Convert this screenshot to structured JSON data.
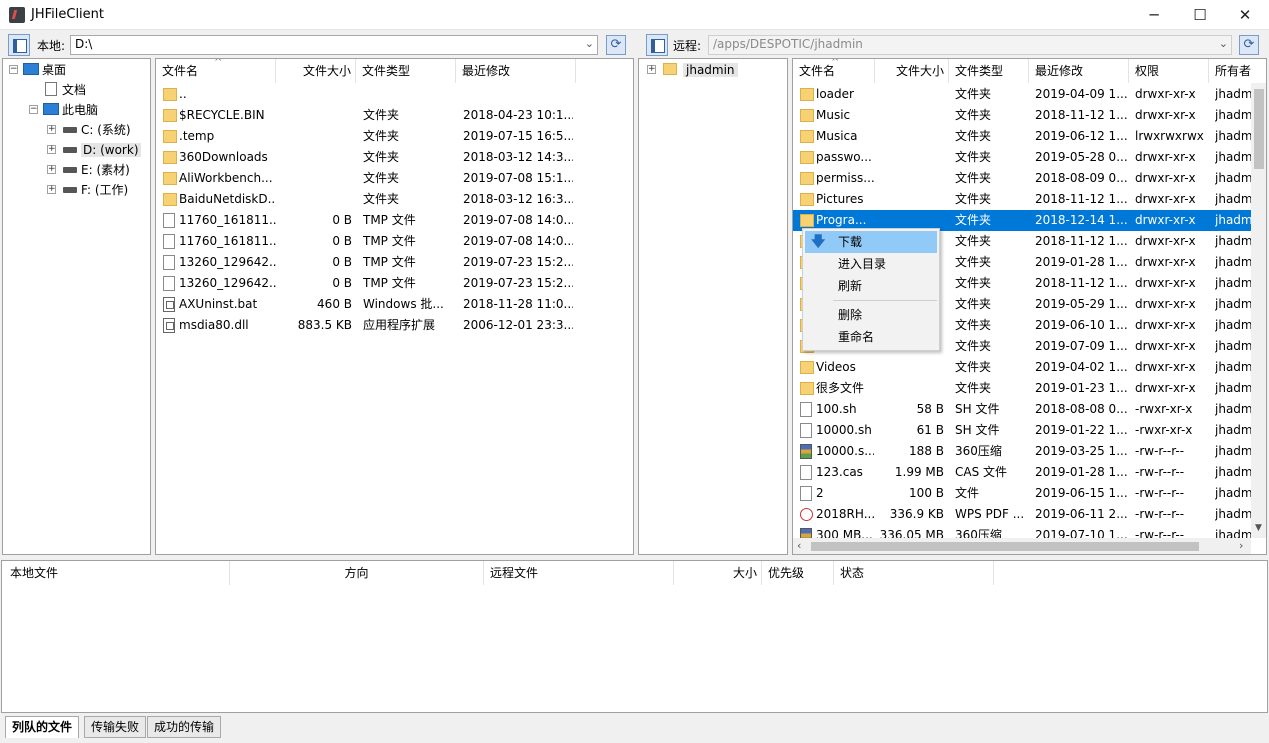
{
  "window": {
    "title": "JHFileClient",
    "minimize": "─",
    "maximize": "☐",
    "close": "✕"
  },
  "local": {
    "label": "本地:",
    "path": "D:\\"
  },
  "remote": {
    "label": "远程:",
    "path": "/apps/DESPOTIC/jhadmin"
  },
  "local_tree": [
    {
      "label": "桌面",
      "icon": "desktop-icon"
    },
    {
      "label": "文档",
      "icon": "document-icon"
    },
    {
      "label": "此电脑",
      "icon": "computer-icon"
    },
    {
      "label": "C: (系统)",
      "icon": "drive-icon"
    },
    {
      "label": "D: (work)",
      "icon": "drive-icon"
    },
    {
      "label": "E: (素材)",
      "icon": "drive-icon"
    },
    {
      "label": "F: (工作)",
      "icon": "drive-icon"
    }
  ],
  "local_columns": [
    "文件名",
    "文件大小",
    "文件类型",
    "最近修改"
  ],
  "local_files": [
    {
      "name": "..",
      "size": "",
      "type": "",
      "modified": "",
      "icon": "folder"
    },
    {
      "name": "$RECYCLE.BIN",
      "size": "",
      "type": "文件夹",
      "modified": "2018-04-23 10:1...",
      "icon": "folder"
    },
    {
      "name": ".temp",
      "size": "",
      "type": "文件夹",
      "modified": "2019-07-15 16:5...",
      "icon": "folder"
    },
    {
      "name": "360Downloads",
      "size": "",
      "type": "文件夹",
      "modified": "2018-03-12 14:3...",
      "icon": "folder"
    },
    {
      "name": "AliWorkbench...",
      "size": "",
      "type": "文件夹",
      "modified": "2019-07-08 15:1...",
      "icon": "folder"
    },
    {
      "name": "BaiduNetdiskD...",
      "size": "",
      "type": "文件夹",
      "modified": "2018-03-12 16:3...",
      "icon": "folder"
    },
    {
      "name": "11760_161811...",
      "size": "0 B",
      "type": "TMP 文件",
      "modified": "2019-07-08 14:0...",
      "icon": "file"
    },
    {
      "name": "11760_161811...",
      "size": "0 B",
      "type": "TMP 文件",
      "modified": "2019-07-08 14:0...",
      "icon": "file"
    },
    {
      "name": "13260_129642...",
      "size": "0 B",
      "type": "TMP 文件",
      "modified": "2019-07-23 15:2...",
      "icon": "file"
    },
    {
      "name": "13260_129642...",
      "size": "0 B",
      "type": "TMP 文件",
      "modified": "2019-07-23 15:2...",
      "icon": "file"
    },
    {
      "name": "AXUninst.bat",
      "size": "460 B",
      "type": "Windows 批...",
      "modified": "2018-11-28 11:0...",
      "icon": "bat"
    },
    {
      "name": "msdia80.dll",
      "size": "883.5 KB",
      "type": "应用程序扩展",
      "modified": "2006-12-01 23:3...",
      "icon": "bat"
    }
  ],
  "remote_tree": [
    {
      "label": "jhadmin",
      "icon": "folder-icon"
    }
  ],
  "remote_columns": [
    "文件名",
    "文件大小",
    "文件类型",
    "最近修改",
    "权限",
    "所有者"
  ],
  "remote_files": [
    {
      "name": "loader",
      "size": "",
      "type": "文件夹",
      "modified": "2019-04-09 1...",
      "perm": "drwxr-xr-x",
      "owner": "jhadm",
      "icon": "folder"
    },
    {
      "name": "Music",
      "size": "",
      "type": "文件夹",
      "modified": "2018-11-12 1...",
      "perm": "drwxr-xr-x",
      "owner": "jhadm",
      "icon": "folder"
    },
    {
      "name": "Musica",
      "size": "",
      "type": "文件夹",
      "modified": "2019-06-12 1...",
      "perm": "lrwxrwxrwx",
      "owner": "jhadm",
      "icon": "folder"
    },
    {
      "name": "passwo...",
      "size": "",
      "type": "文件夹",
      "modified": "2019-05-28 0...",
      "perm": "drwxr-xr-x",
      "owner": "jhadm",
      "icon": "folder"
    },
    {
      "name": "permiss...",
      "size": "",
      "type": "文件夹",
      "modified": "2018-08-09 0...",
      "perm": "drwxr-xr-x",
      "owner": "jhadm",
      "icon": "folder"
    },
    {
      "name": "Pictures",
      "size": "",
      "type": "文件夹",
      "modified": "2018-11-12 1...",
      "perm": "drwxr-xr-x",
      "owner": "jhadm",
      "icon": "folder"
    },
    {
      "name": "Progra...",
      "size": "",
      "type": "文件夹",
      "modified": "2018-12-14 1...",
      "perm": "drwxr-xr-x",
      "owner": "jhadm",
      "icon": "folder",
      "selected": true
    },
    {
      "name": "",
      "size": "",
      "type": "文件夹",
      "modified": "2018-11-12 1...",
      "perm": "drwxr-xr-x",
      "owner": "jhadm",
      "icon": "folder"
    },
    {
      "name": "",
      "size": "",
      "type": "文件夹",
      "modified": "2019-01-28 1...",
      "perm": "drwxr-xr-x",
      "owner": "jhadm",
      "icon": "folder"
    },
    {
      "name": "",
      "size": "",
      "type": "文件夹",
      "modified": "2018-11-12 1...",
      "perm": "drwxr-xr-x",
      "owner": "jhadm",
      "icon": "folder"
    },
    {
      "name": "",
      "size": "",
      "type": "文件夹",
      "modified": "2019-05-29 1...",
      "perm": "drwxr-xr-x",
      "owner": "jhadm",
      "icon": "folder"
    },
    {
      "name": "",
      "size": "",
      "type": "文件夹",
      "modified": "2019-06-10 1...",
      "perm": "drwxr-xr-x",
      "owner": "jhadm",
      "icon": "folder"
    },
    {
      "name": "",
      "size": "",
      "type": "文件夹",
      "modified": "2019-07-09 1...",
      "perm": "drwxr-xr-x",
      "owner": "jhadm",
      "icon": "folder"
    },
    {
      "name": "Videos",
      "size": "",
      "type": "文件夹",
      "modified": "2019-04-02 1...",
      "perm": "drwxr-xr-x",
      "owner": "jhadm",
      "icon": "folder"
    },
    {
      "name": "很多文件",
      "size": "",
      "type": "文件夹",
      "modified": "2019-01-23 1...",
      "perm": "drwxr-xr-x",
      "owner": "jhadm",
      "icon": "folder"
    },
    {
      "name": "100.sh",
      "size": "58 B",
      "type": "SH 文件",
      "modified": "2018-08-08 0...",
      "perm": "-rwxr-xr-x",
      "owner": "jhadm",
      "icon": "file"
    },
    {
      "name": "10000.sh",
      "size": "61 B",
      "type": "SH 文件",
      "modified": "2019-01-22 1...",
      "perm": "-rwxr-xr-x",
      "owner": "jhadm",
      "icon": "file"
    },
    {
      "name": "10000.s...",
      "size": "188 B",
      "type": "360压缩",
      "modified": "2019-03-25 1...",
      "perm": "-rw-r--r--",
      "owner": "jhadm",
      "icon": "zip"
    },
    {
      "name": "123.cas",
      "size": "1.99 MB",
      "type": "CAS 文件",
      "modified": "2019-01-28 1...",
      "perm": "-rw-r--r--",
      "owner": "jhadm",
      "icon": "file"
    },
    {
      "name": "2",
      "size": "100 B",
      "type": "文件",
      "modified": "2019-06-15 1...",
      "perm": "-rw-r--r--",
      "owner": "jhadm",
      "icon": "file"
    },
    {
      "name": "2018RH...",
      "size": "336.9 KB",
      "type": "WPS PDF ...",
      "modified": "2019-06-11 2...",
      "perm": "-rw-r--r--",
      "owner": "jhadm",
      "icon": "pdf"
    },
    {
      "name": "300 MB...",
      "size": "336.05 MB",
      "type": "360压缩",
      "modified": "2019-07-10 1...",
      "perm": "-rw-r--r--",
      "owner": "jhadm",
      "icon": "zip"
    }
  ],
  "context_menu": [
    "下载",
    "进入目录",
    "刷新",
    "删除",
    "重命名"
  ],
  "queue_columns": [
    "本地文件",
    "方向",
    "远程文件",
    "大小",
    "优先级",
    "状态"
  ],
  "tabs": [
    "列队的文件",
    "传输失败",
    "成功的传输"
  ]
}
